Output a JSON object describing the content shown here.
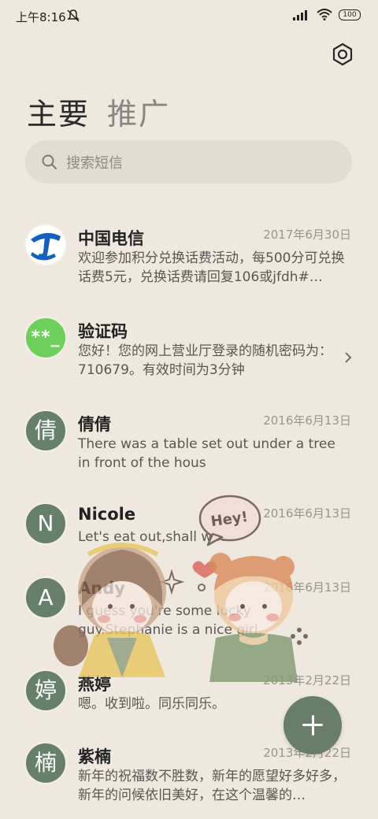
{
  "status_bar": {
    "time": "上午8:16",
    "battery": "100",
    "icons": [
      "mute-icon",
      "signal-icon",
      "wifi-icon",
      "battery-icon"
    ]
  },
  "header": {
    "settings_icon": "settings-icon"
  },
  "tabs": [
    {
      "label": "主要",
      "active": true
    },
    {
      "label": "推广",
      "active": false
    }
  ],
  "search": {
    "placeholder": "搜索短信",
    "icon": "search-icon"
  },
  "messages": [
    {
      "avatar_type": "telecom-logo",
      "name": "中国电信",
      "date": "2017年6月30日",
      "preview": "欢迎参加积分兑换话费活动，每500分可兑换话费5元，兑换话费请回复106或jfdh#…"
    },
    {
      "avatar_type": "verification-code",
      "avatar_text": "**_",
      "name": "验证码",
      "date": "",
      "preview": "您好！您的网上营业厅登录的随机密码为：710679。有效时间为3分钟",
      "has_chevron": true
    },
    {
      "avatar_type": "letter",
      "avatar_text": "倩",
      "name": "倩倩",
      "date": "2016年6月13日",
      "preview": "There was a table set out under a tree in front of the hous"
    },
    {
      "avatar_type": "letter",
      "avatar_text": "N",
      "name": "Nicole",
      "date": "2016年6月13日",
      "preview": "Let's eat out,shall we?"
    },
    {
      "avatar_type": "letter",
      "avatar_text": "A",
      "name": "Andy",
      "date": "2016年6月13日",
      "preview": "I guess you're some lucky guy.Stephanie is a nice girl."
    },
    {
      "avatar_type": "letter",
      "avatar_text": "婷",
      "name": "燕婷",
      "date": "2013年2月22日",
      "preview": "嗯。收到啦。同乐同乐。"
    },
    {
      "avatar_type": "letter",
      "avatar_text": "楠",
      "name": "紫楠",
      "date": "2013年2月22日",
      "preview": "新年的祝福数不胜数，新年的愿望好多好多，新年的问候依旧美好，在这个温馨的…"
    }
  ],
  "sticker": {
    "bubble_text": "Hey!"
  },
  "fab": {
    "icon": "plus-icon"
  },
  "colors": {
    "background": "#efe8df",
    "avatar_green": "#67806a",
    "fab_green": "#697d6b",
    "code_green": "#6fcf5b"
  }
}
